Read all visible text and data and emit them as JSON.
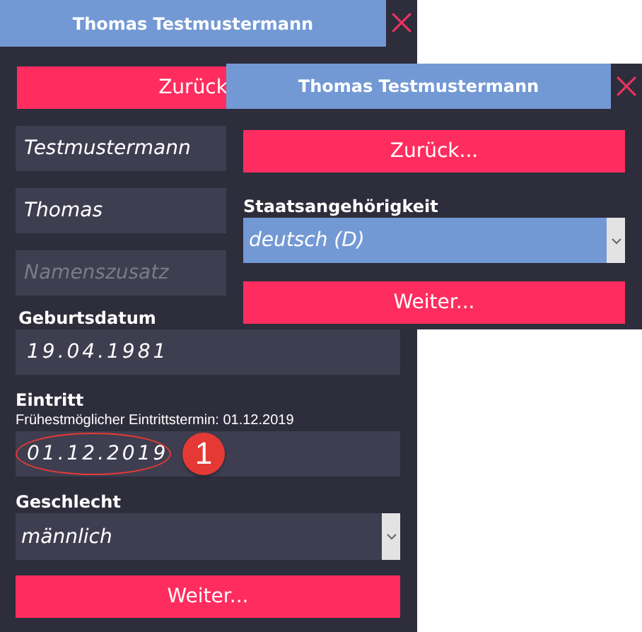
{
  "back_window": {
    "title": "Thomas Testmustermann",
    "back_button": "Zurück",
    "fields": [
      {
        "value": "Testmustermann"
      },
      {
        "value": "Thomas"
      },
      {
        "placeholder": "Namenszusatz"
      }
    ],
    "birth_date": {
      "label": "Geburtsdatum",
      "value": "19.04.1981"
    },
    "entry": {
      "label": "Eintritt",
      "hint": "Frühestmöglicher Eintrittstermin: 01.12.2019",
      "value": "01.12.2019",
      "annotation": "1"
    },
    "gender": {
      "label": "Geschlecht",
      "value": "männlich"
    },
    "next_button": "Weiter..."
  },
  "front_window": {
    "title": "Thomas Testmustermann",
    "back_button": "Zurück...",
    "nationality": {
      "label": "Staatsangehörigkeit",
      "value": "deutsch (D)"
    },
    "next_button": "Weiter..."
  }
}
